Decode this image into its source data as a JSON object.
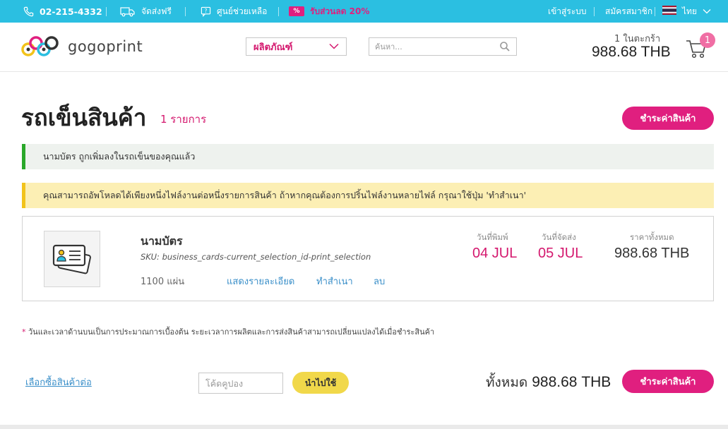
{
  "topbar": {
    "phone": "02-215-4332",
    "shipping": "จัดส่งฟรี",
    "help": "ศูนย์ช่วยเหลือ",
    "promo_badge": "%",
    "promo": "รับส่วนลด 20%",
    "login": "เข้าสู่ระบบ",
    "signup": "สมัครสมาชิก",
    "language": "ไทย",
    "colors": {
      "bar": "#2bbfe1",
      "promo": "#e01f7f"
    }
  },
  "header": {
    "logo_text": "gogoprint",
    "product_menu": "ผลิตภัณฑ์",
    "search_placeholder": "ค้นหา...",
    "cart_count_label": "1 ในตะกร้า",
    "cart_total": "988.68 THB",
    "cart_badge": "1"
  },
  "page": {
    "title": "รถเข็นสินค้า",
    "item_count": "1 รายการ",
    "checkout_label": "ชำระค่าสินค้า",
    "success_message": "นามบัตร ถูกเพิ่มลงในรถเข็นของคุณแล้ว",
    "warning_message": "คุณสามารถอัพโหลดได้เพียงหนึ่งไฟล์งานต่อหนึ่งรายการสินค้า ถ้าหากคุณต้องการปริ้นไฟล์งานหลายไฟล์ กรุณาใช้ปุ่ม 'ทำสำเนา'"
  },
  "cart_item": {
    "name": "นามบัตร",
    "sku": "SKU: business_cards-current_selection_id-print_selection",
    "quantity": "1100 แผ่น",
    "actions": {
      "details": "แสดงรายละเอียด",
      "duplicate": "ทำสำเนา",
      "delete": "ลบ"
    },
    "print_date_label": "วันที่พิมพ์",
    "print_date": "04 JUL",
    "ship_date_label": "วันที่จัดส่ง",
    "ship_date": "05 JUL",
    "total_label": "ราคาทั้งหมด",
    "total": "988.68 THB"
  },
  "footer": {
    "note_star": "*",
    "note": "วันและเวลาด้านบนเป็นการประมาณการเบื้องต้น ระยะเวลาการผลิตและการส่งสินค้าสามารถเปลี่ยนแปลงได้เมื่อชำระสินค้า",
    "continue_shopping": "เลือกซื้อสินค้าต่อ",
    "coupon_placeholder": "โค้ดคูปอง",
    "apply_label": "นำไปใช้",
    "total_label": "ทั้งหมด",
    "total": "988.68 THB",
    "checkout_label": "ชำระค่าสินค้า"
  }
}
